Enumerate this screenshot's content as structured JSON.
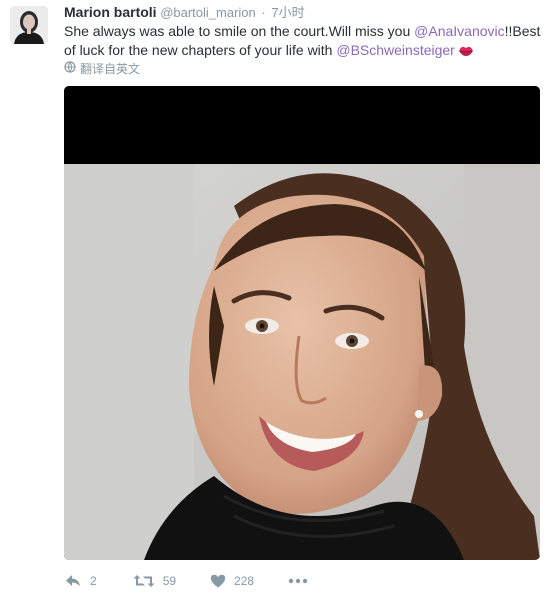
{
  "tweet": {
    "display_name": "Marion bartoli",
    "handle": "@bartoli_marion",
    "separator": "·",
    "time": "7小时",
    "text_part1": "She always was able to smile on the court.Will miss you ",
    "mention1": "@AnaIvanovic",
    "text_part2": "!!Best of luck for the new chapters of your life with ",
    "mention2": "@BSchweinsteiger",
    "emoji": "kiss-lips-icon",
    "translate_label": "翻译自英文"
  },
  "actions": {
    "reply_count": "2",
    "retweet_count": "59",
    "like_count": "228"
  },
  "colors": {
    "mention": "#8a6ab6",
    "muted": "#8899a6",
    "text": "#292f33"
  }
}
